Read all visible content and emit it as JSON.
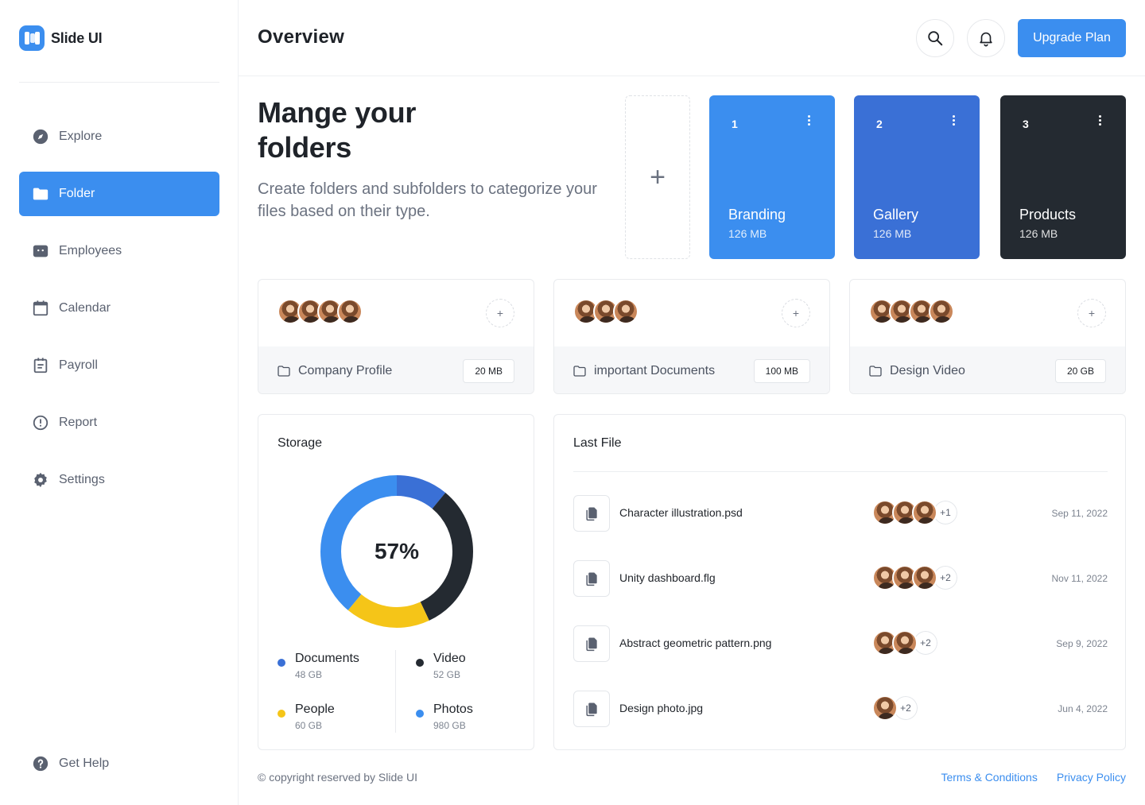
{
  "app": {
    "name": "Slide UI"
  },
  "colors": {
    "primary": "#3b8eef",
    "secondary": "#3a70d6",
    "dark": "#242a31",
    "yellow": "#f5c518"
  },
  "sidebar": {
    "items": [
      {
        "label": "Explore",
        "icon": "compass-icon",
        "active": false
      },
      {
        "label": "Folder",
        "icon": "folder-icon",
        "active": true
      },
      {
        "label": "Employees",
        "icon": "employees-icon",
        "active": false
      },
      {
        "label": "Calendar",
        "icon": "calendar-icon",
        "active": false
      },
      {
        "label": "Payroll",
        "icon": "payroll-icon",
        "active": false
      },
      {
        "label": "Report",
        "icon": "alert-circle-icon",
        "active": false
      },
      {
        "label": "Settings",
        "icon": "gear-icon",
        "active": false
      }
    ],
    "help": {
      "label": "Get Help",
      "icon": "help-circle-icon"
    }
  },
  "header": {
    "title": "Overview",
    "upgrade_label": "Upgrade Plan"
  },
  "hero": {
    "title": "Mange your folders",
    "subtitle": "Create folders and subfolders to categorize your files based on their type.",
    "add_symbol": "+"
  },
  "folders": [
    {
      "number": "1",
      "name": "Branding",
      "size": "126 MB"
    },
    {
      "number": "2",
      "name": "Gallery",
      "size": "126 MB"
    },
    {
      "number": "3",
      "name": "Products",
      "size": "126 MB"
    }
  ],
  "shared_folders": [
    {
      "name": "Company Profile",
      "size": "20 MB",
      "members": 4
    },
    {
      "name": "important Documents",
      "size": "100 MB",
      "members": 3
    },
    {
      "name": "Design Video",
      "size": "20 GB",
      "members": 4
    }
  ],
  "storage": {
    "title": "Storage",
    "percent_label": "57%",
    "legend": [
      {
        "name": "Documents",
        "size": "48 GB",
        "color": "#3a70d6"
      },
      {
        "name": "Video",
        "size": "52 GB",
        "color": "#242a31"
      },
      {
        "name": "People",
        "size": "60 GB",
        "color": "#f5c518"
      },
      {
        "name": "Photos",
        "size": "980 GB",
        "color": "#3b8eef"
      }
    ],
    "segments_fraction": [
      0.11,
      0.32,
      0.18,
      0.39
    ]
  },
  "last_file": {
    "title": "Last File",
    "rows": [
      {
        "name": "Character illustration.psd",
        "avatars": 3,
        "more": "+1",
        "date": "Sep 11, 2022"
      },
      {
        "name": "Unity dashboard.flg",
        "avatars": 3,
        "more": "+2",
        "date": "Nov 11, 2022"
      },
      {
        "name": "Abstract geometric pattern.png",
        "avatars": 2,
        "more": "+2",
        "date": "Sep 9, 2022"
      },
      {
        "name": "Design photo.jpg",
        "avatars": 1,
        "more": "+2",
        "date": "Jun 4, 2022"
      }
    ]
  },
  "footer": {
    "copyright": "© copyright reserved by Slide UI",
    "links": [
      "Terms & Conditions",
      "Privacy Policy"
    ]
  }
}
